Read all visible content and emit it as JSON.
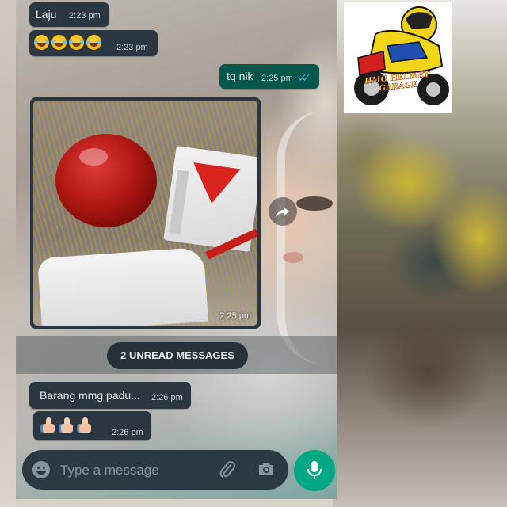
{
  "chat": {
    "messages": [
      {
        "direction": "in",
        "text": "Laju",
        "time": "2:23 pm"
      },
      {
        "direction": "in",
        "emoji": [
          "face-with-tears-of-joy",
          "face-with-tears-of-joy",
          "face-with-tears-of-joy",
          "face-with-tears-of-joy"
        ],
        "time": "2:23 pm"
      },
      {
        "direction": "out",
        "text": "tq nik",
        "time": "2:25 pm",
        "status": "read"
      },
      {
        "direction": "in",
        "type": "image",
        "time": "2:25 pm"
      },
      {
        "direction": "in",
        "text": "Barang mmg padu...",
        "time": "2:26 pm"
      },
      {
        "direction": "in",
        "emoji": [
          "thumbs-up-light-skin",
          "thumbs-up-light-skin",
          "thumbs-up-light-skin"
        ],
        "time": "2:26 pm"
      }
    ],
    "unread_banner": "2 UNREAD MESSAGES"
  },
  "input_bar": {
    "placeholder": "Type a message",
    "emoji_icon": "smiley-icon",
    "attach_icon": "paperclip-icon",
    "camera_icon": "camera-icon",
    "mic_icon": "microphone-icon"
  },
  "image_actions": {
    "share_icon": "forward-arrow-icon"
  },
  "colors": {
    "incoming_bubble": "#2a3640",
    "outgoing_bubble": "#05574b",
    "read_ticks": "#53bdeb",
    "mic_button": "#00a884",
    "input_bar": "#2b3942"
  },
  "logo": {
    "text": "HMG HELMET GARAGE"
  }
}
